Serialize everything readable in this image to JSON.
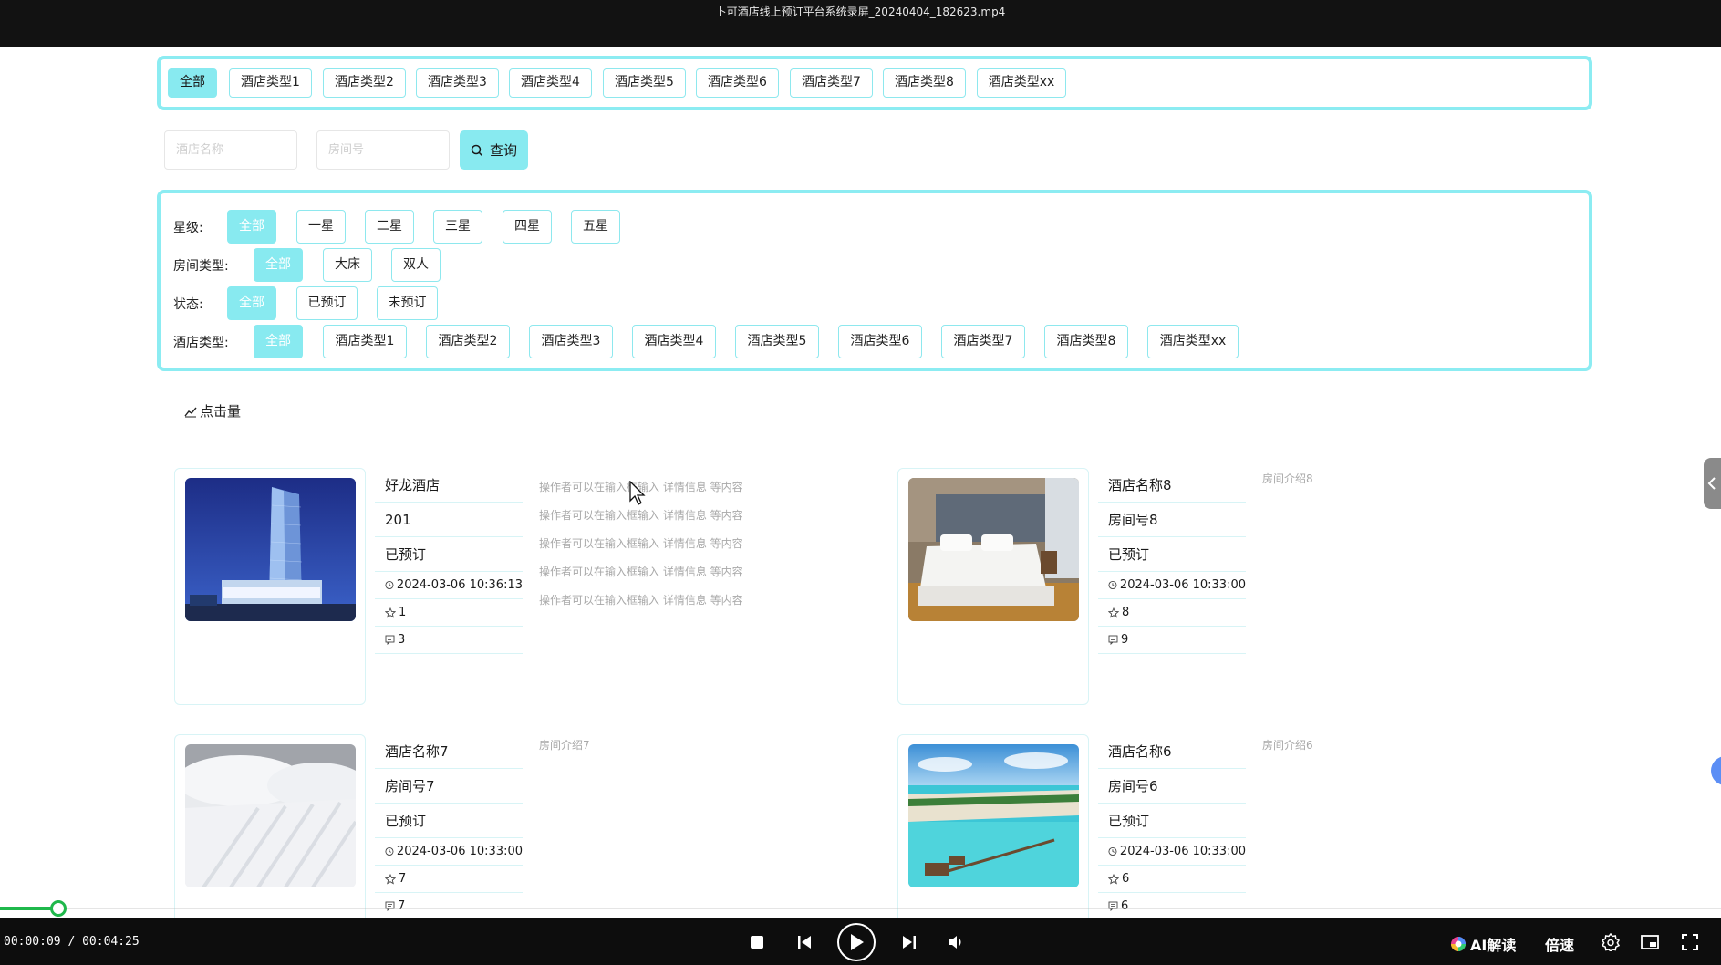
{
  "player": {
    "title": "卜可酒店线上预订平台系统录屏_20240404_182623.mp4",
    "time_readout": "00:00:09 / 00:04:25",
    "progress": 0.034,
    "ai_label": "AI解读",
    "speed_label": "倍速"
  },
  "top_tabs": [
    "全部",
    "酒店类型1",
    "酒店类型2",
    "酒店类型3",
    "酒店类型4",
    "酒店类型5",
    "酒店类型6",
    "酒店类型7",
    "酒店类型8",
    "酒店类型xx"
  ],
  "search": {
    "hotel_name_placeholder": "酒店名称",
    "room_no_placeholder": "房间号",
    "query_label": "查询"
  },
  "filters": {
    "star": {
      "label": "星级:",
      "options": [
        "全部",
        "一星",
        "二星",
        "三星",
        "四星",
        "五星"
      ]
    },
    "room_type": {
      "label": "房间类型:",
      "options": [
        "全部",
        "大床",
        "双人"
      ]
    },
    "status": {
      "label": "状态:",
      "options": [
        "全部",
        "已预订",
        "未预订"
      ]
    },
    "hotel_type": {
      "label": "酒店类型:",
      "options": [
        "全部",
        "酒店类型1",
        "酒店类型2",
        "酒店类型3",
        "酒店类型4",
        "酒店类型5",
        "酒店类型6",
        "酒店类型7",
        "酒店类型8",
        "酒店类型xx"
      ]
    }
  },
  "sort_label": "点击量",
  "hotels": [
    {
      "name": "好龙酒店",
      "room": "201",
      "status": "已预订",
      "time": "2024-03-06 10:36:13",
      "stars": "1",
      "comments": "3",
      "desc": [
        "操作者可以在输入框输入   详情信息   等内容",
        "操作者可以在输入框输入   详情信息   等内容",
        "操作者可以在输入框输入   详情信息   等内容",
        "操作者可以在输入框输入   详情信息   等内容",
        "操作者可以在输入框输入   详情信息   等内容"
      ],
      "image": "tower-image"
    },
    {
      "name": "酒店名称8",
      "room": "房间号8",
      "status": "已预订",
      "time": "2024-03-06 10:33:00",
      "stars": "8",
      "comments": "9",
      "desc": [
        "房间介绍8"
      ],
      "image": "bedroom-image"
    },
    {
      "name": "酒店名称7",
      "room": "房间号7",
      "status": "已预订",
      "time": "2024-03-06 10:33:00",
      "stars": "7",
      "comments": "7",
      "desc": [
        "房间介绍7"
      ],
      "image": "linen-image"
    },
    {
      "name": "酒店名称6",
      "room": "房间号6",
      "status": "已预订",
      "time": "2024-03-06 10:33:00",
      "stars": "6",
      "comments": "6",
      "desc": [
        "房间介绍6"
      ],
      "image": "beach-image"
    }
  ]
}
